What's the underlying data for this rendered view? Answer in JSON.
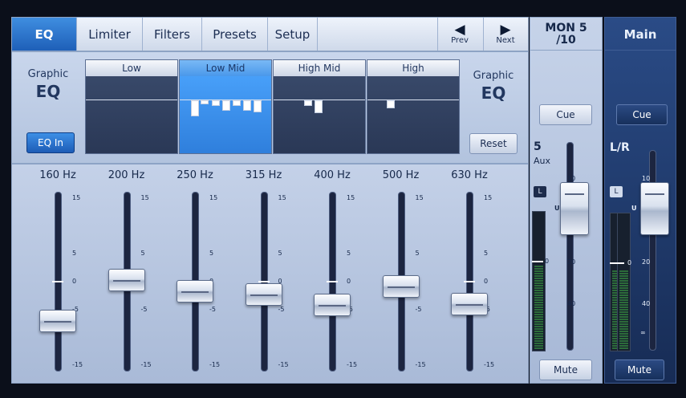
{
  "tabs": [
    {
      "label": "EQ",
      "active": true
    },
    {
      "label": "Limiter",
      "active": false
    },
    {
      "label": "Filters",
      "active": false
    },
    {
      "label": "Presets",
      "active": false
    },
    {
      "label": "Setup",
      "active": false
    }
  ],
  "nav": {
    "prev_label": "Prev",
    "next_label": "Next",
    "prev_icon": "triangle-left-icon",
    "next_icon": "triangle-right-icon"
  },
  "geq_left": {
    "line1": "Graphic",
    "line2": "EQ"
  },
  "geq_right": {
    "line1": "Graphic",
    "line2": "EQ"
  },
  "eq_in_label": "EQ In",
  "reset_label": "Reset",
  "bands": [
    {
      "label": "Low",
      "active": false
    },
    {
      "label": "Low Mid",
      "active": true
    },
    {
      "label": "High Mid",
      "active": false
    },
    {
      "label": "High",
      "active": false
    }
  ],
  "fader_scale": [
    "15",
    "5",
    "0",
    "-5",
    "-15"
  ],
  "faders": [
    {
      "freq": "160 Hz",
      "level_db": -7
    },
    {
      "freq": "200 Hz",
      "level_db": 0.3
    },
    {
      "freq": "250 Hz",
      "level_db": -1.7
    },
    {
      "freq": "315 Hz",
      "level_db": -2.3
    },
    {
      "freq": "400 Hz",
      "level_db": -4.2
    },
    {
      "freq": "500 Hz",
      "level_db": -0.9
    },
    {
      "freq": "630 Hz",
      "level_db": -4
    }
  ],
  "mon": {
    "title_line1": "MON 5",
    "title_line2": "/10",
    "cue_label": "Cue",
    "channel_number": "5",
    "channel_name": "Aux",
    "l_badge": "L",
    "unity_flag": "U",
    "meter_zero": "0",
    "scale": [
      "10",
      "20",
      "40",
      "∞"
    ],
    "mute_label": "Mute"
  },
  "main": {
    "title": "Main",
    "cue_label": "Cue",
    "channel_name": "L/R",
    "l_badge": "L",
    "unity_flag": "U",
    "meter_zero": "0",
    "scale": [
      "10",
      "20",
      "40",
      "∞"
    ],
    "mute_label": "Mute"
  },
  "colors": {
    "accent": "#1e5fb8",
    "active_band": "#4da6ff",
    "main_strip": "#1f3a6e"
  }
}
